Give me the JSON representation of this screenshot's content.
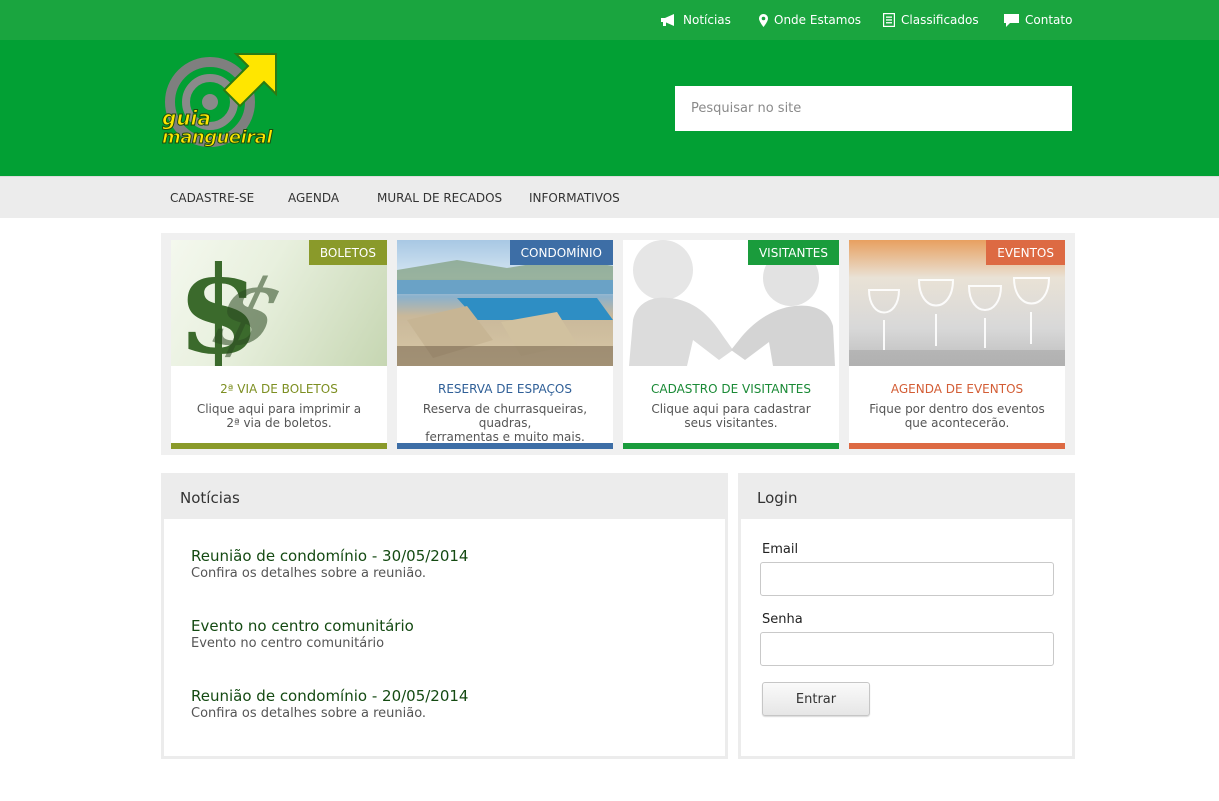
{
  "topbar": {
    "links": [
      {
        "label": "Notícias",
        "icon": "megaphone-icon"
      },
      {
        "label": "Onde Estamos",
        "icon": "map-pin-icon"
      },
      {
        "label": "Classificados",
        "icon": "document-icon"
      },
      {
        "label": "Contato",
        "icon": "speech-bubble-icon"
      }
    ]
  },
  "header": {
    "logo": {
      "line1": "guia",
      "line2": "mangueiral"
    },
    "search_placeholder": "Pesquisar no site"
  },
  "nav": {
    "items": [
      "CADASTRE-SE",
      "AGENDA",
      "MURAL DE RECADOS",
      "INFORMATIVOS"
    ]
  },
  "features": [
    {
      "tag": "BOLETOS",
      "title": "2ª VIA DE BOLETOS",
      "desc1": "Clique aqui para imprimir a",
      "desc2": "2ª via de boletos.",
      "color": "#8a9a2a"
    },
    {
      "tag": "CONDOMÍNIO",
      "title": "RESERVA DE ESPAÇOS",
      "desc1": "Reserva de churrasqueiras, quadras,",
      "desc2": "ferramentas e muito mais.",
      "color": "#3d6ea6"
    },
    {
      "tag": "VISITANTES",
      "title": "CADASTRO DE VISITANTES",
      "desc1": "Clique aqui para cadastrar",
      "desc2": "seus visitantes.",
      "color": "#1a9c3c"
    },
    {
      "tag": "EVENTOS",
      "title": "AGENDA DE EVENTOS",
      "desc1": "Fique por dentro dos eventos",
      "desc2": "que acontecerão.",
      "color": "#dd6a43"
    }
  ],
  "news": {
    "heading": "Notícias",
    "items": [
      {
        "title": "Reunião de condomínio - 30/05/2014",
        "summary": "Confira os detalhes sobre a reunião."
      },
      {
        "title": "Evento no centro comunitário",
        "summary": "Evento no centro comunitário"
      },
      {
        "title": "Reunião de condomínio - 20/05/2014",
        "summary": "Confira os detalhes sobre a reunião."
      }
    ]
  },
  "login": {
    "heading": "Login",
    "email_label": "Email",
    "email_value": "",
    "password_label": "Senha",
    "password_value": "",
    "submit_label": "Entrar"
  }
}
